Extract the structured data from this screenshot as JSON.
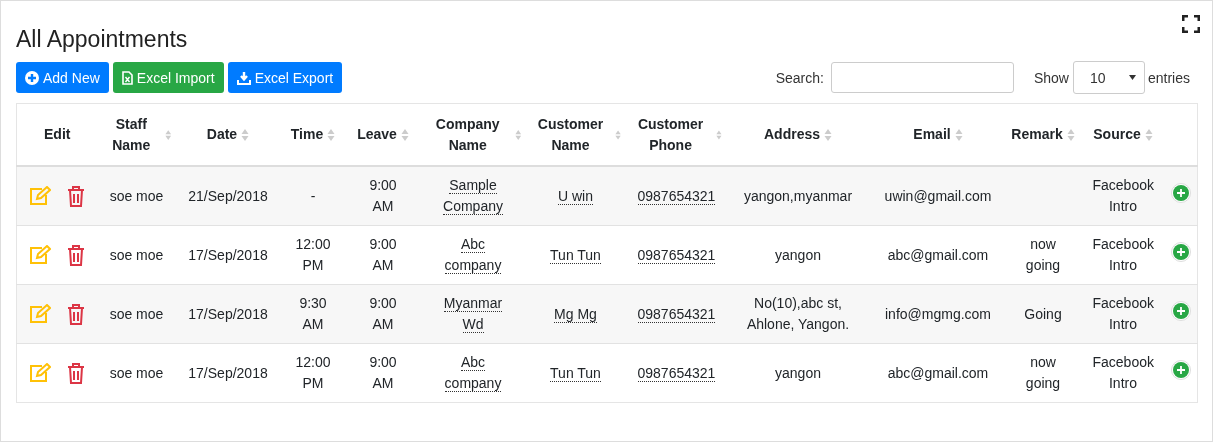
{
  "title": "All Appointments",
  "buttons": [
    {
      "label": "Add New",
      "kind": "add"
    },
    {
      "label": "Excel Import",
      "kind": "import"
    },
    {
      "label": "Excel Export",
      "kind": "export"
    }
  ],
  "search": {
    "label": "Search:"
  },
  "length": {
    "before": "Show",
    "value": "10",
    "after": "entries"
  },
  "columns": [
    {
      "label": "Edit",
      "sortable": false
    },
    {
      "label": "Staff Name",
      "sortable": true
    },
    {
      "label": "Date",
      "sortable": true
    },
    {
      "label": "Time",
      "sortable": true
    },
    {
      "label": "Leave",
      "sortable": true
    },
    {
      "label": "Company Name",
      "sortable": true
    },
    {
      "label": "Customer Name",
      "sortable": true
    },
    {
      "label": "Customer Phone",
      "sortable": true
    },
    {
      "label": "Address",
      "sortable": true
    },
    {
      "label": "Email",
      "sortable": true
    },
    {
      "label": "Remark",
      "sortable": true
    },
    {
      "label": "Source",
      "sortable": true
    }
  ],
  "rows": [
    {
      "staff": "soe moe",
      "date": "21/Sep/2018",
      "time": "-",
      "leave": "9:00 AM",
      "company": "Sample Company",
      "customer": "U win",
      "phone": "0987654321",
      "address": "yangon,myanmar",
      "email": "uwin@gmail.com",
      "remark": "",
      "source": "Facebook Intro"
    },
    {
      "staff": "soe moe",
      "date": "17/Sep/2018",
      "time": "12:00 PM",
      "leave": "9:00 AM",
      "company": "Abc company",
      "customer": "Tun Tun",
      "phone": "0987654321",
      "address": "yangon",
      "email": "abc@gmail.com",
      "remark": "now going",
      "source": "Facebook Intro"
    },
    {
      "staff": "soe moe",
      "date": "17/Sep/2018",
      "time": "9:30 AM",
      "leave": "9:00 AM",
      "company": "Myanmar Wd",
      "customer": "Mg Mg",
      "phone": "0987654321",
      "address": "No(10),abc st, Ahlone, Yangon.",
      "email": "info@mgmg.com",
      "remark": "Going",
      "source": "Facebook Intro"
    },
    {
      "staff": "soe moe",
      "date": "17/Sep/2018",
      "time": "12:00 PM",
      "leave": "9:00 AM",
      "company": "Abc company",
      "customer": "Tun Tun",
      "phone": "0987654321",
      "address": "yangon",
      "email": "abc@gmail.com",
      "remark": "now going",
      "source": "Facebook Intro"
    }
  ]
}
